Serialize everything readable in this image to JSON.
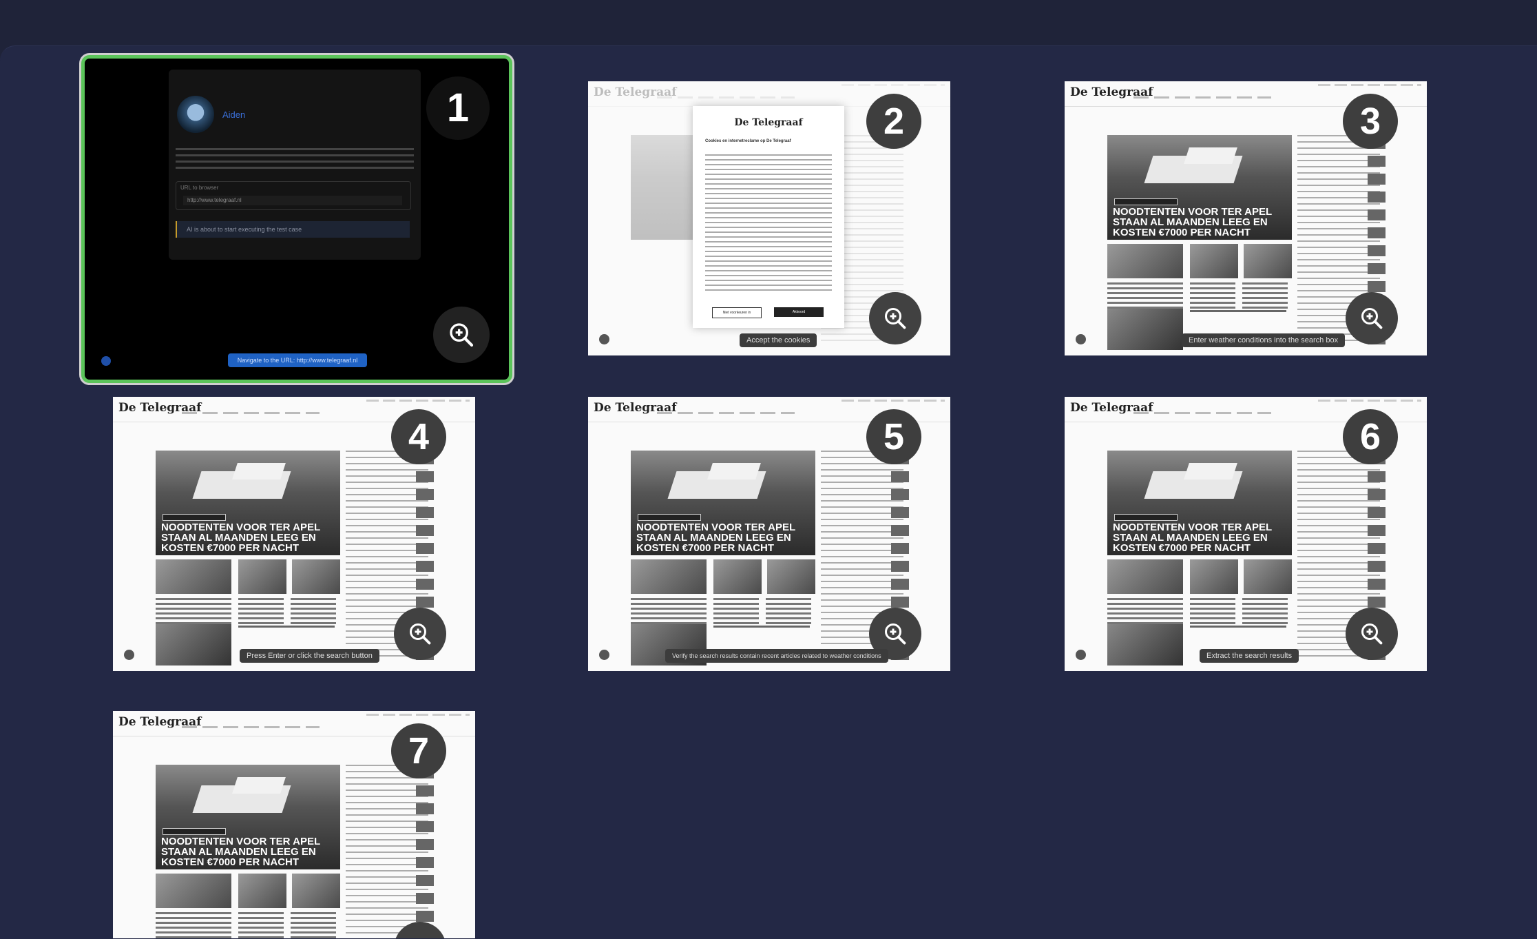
{
  "cards": [
    {
      "number": "1",
      "type": "agent",
      "agent_name": "Aiden",
      "url_label": "URL to browser",
      "url_value": "http://www.telegraaf.nl",
      "status": "AI is about to start executing the test case",
      "caption": "Navigate to the URL: http://www.telegraaf.nl"
    },
    {
      "number": "2",
      "type": "cookie",
      "logo": "De Telegraaf",
      "modal_title": "Cookies en internetreclame op De Telegraaf",
      "decline_label": "Niet voorkeuren in",
      "accept_label": "Akkoord",
      "caption": "Accept the cookies"
    },
    {
      "number": "3",
      "type": "news",
      "logo": "De Telegraaf",
      "headline": [
        "NOODTENTEN VOOR TER APEL",
        "STAAN AL MAANDEN LEEG EN",
        "KOSTEN €7000 PER NACHT"
      ],
      "caption": "Enter weather conditions into the search box"
    },
    {
      "number": "4",
      "type": "news",
      "logo": "De Telegraaf",
      "headline": [
        "NOODTENTEN VOOR TER APEL",
        "STAAN AL MAANDEN LEEG EN",
        "KOSTEN €7000 PER NACHT"
      ],
      "caption": "Press Enter or click the search button"
    },
    {
      "number": "5",
      "type": "news",
      "logo": "De Telegraaf",
      "headline": [
        "NOODTENTEN VOOR TER APEL",
        "STAAN AL MAANDEN LEEG EN",
        "KOSTEN €7000 PER NACHT"
      ],
      "caption": "Verify the search results contain recent articles related to weather conditions"
    },
    {
      "number": "6",
      "type": "news",
      "logo": "De Telegraaf",
      "headline": [
        "NOODTENTEN VOOR TER APEL",
        "STAAN AL MAANDEN LEEG EN",
        "KOSTEN €7000 PER NACHT"
      ],
      "caption": "Extract the search results"
    },
    {
      "number": "7",
      "type": "news",
      "logo": "De Telegraaf",
      "headline": [
        "NOODTENTEN VOOR TER APEL",
        "STAAN AL MAANDEN LEEG EN",
        "KOSTEN €7000 PER NACHT"
      ],
      "caption": ""
    }
  ],
  "colors": {
    "background": "#1f2339",
    "panel": "#232845",
    "active_border": "#5bc45a",
    "badge": "#3e3e3e"
  },
  "icons": {
    "zoom": "zoom-in-icon",
    "info": "info-icon"
  }
}
